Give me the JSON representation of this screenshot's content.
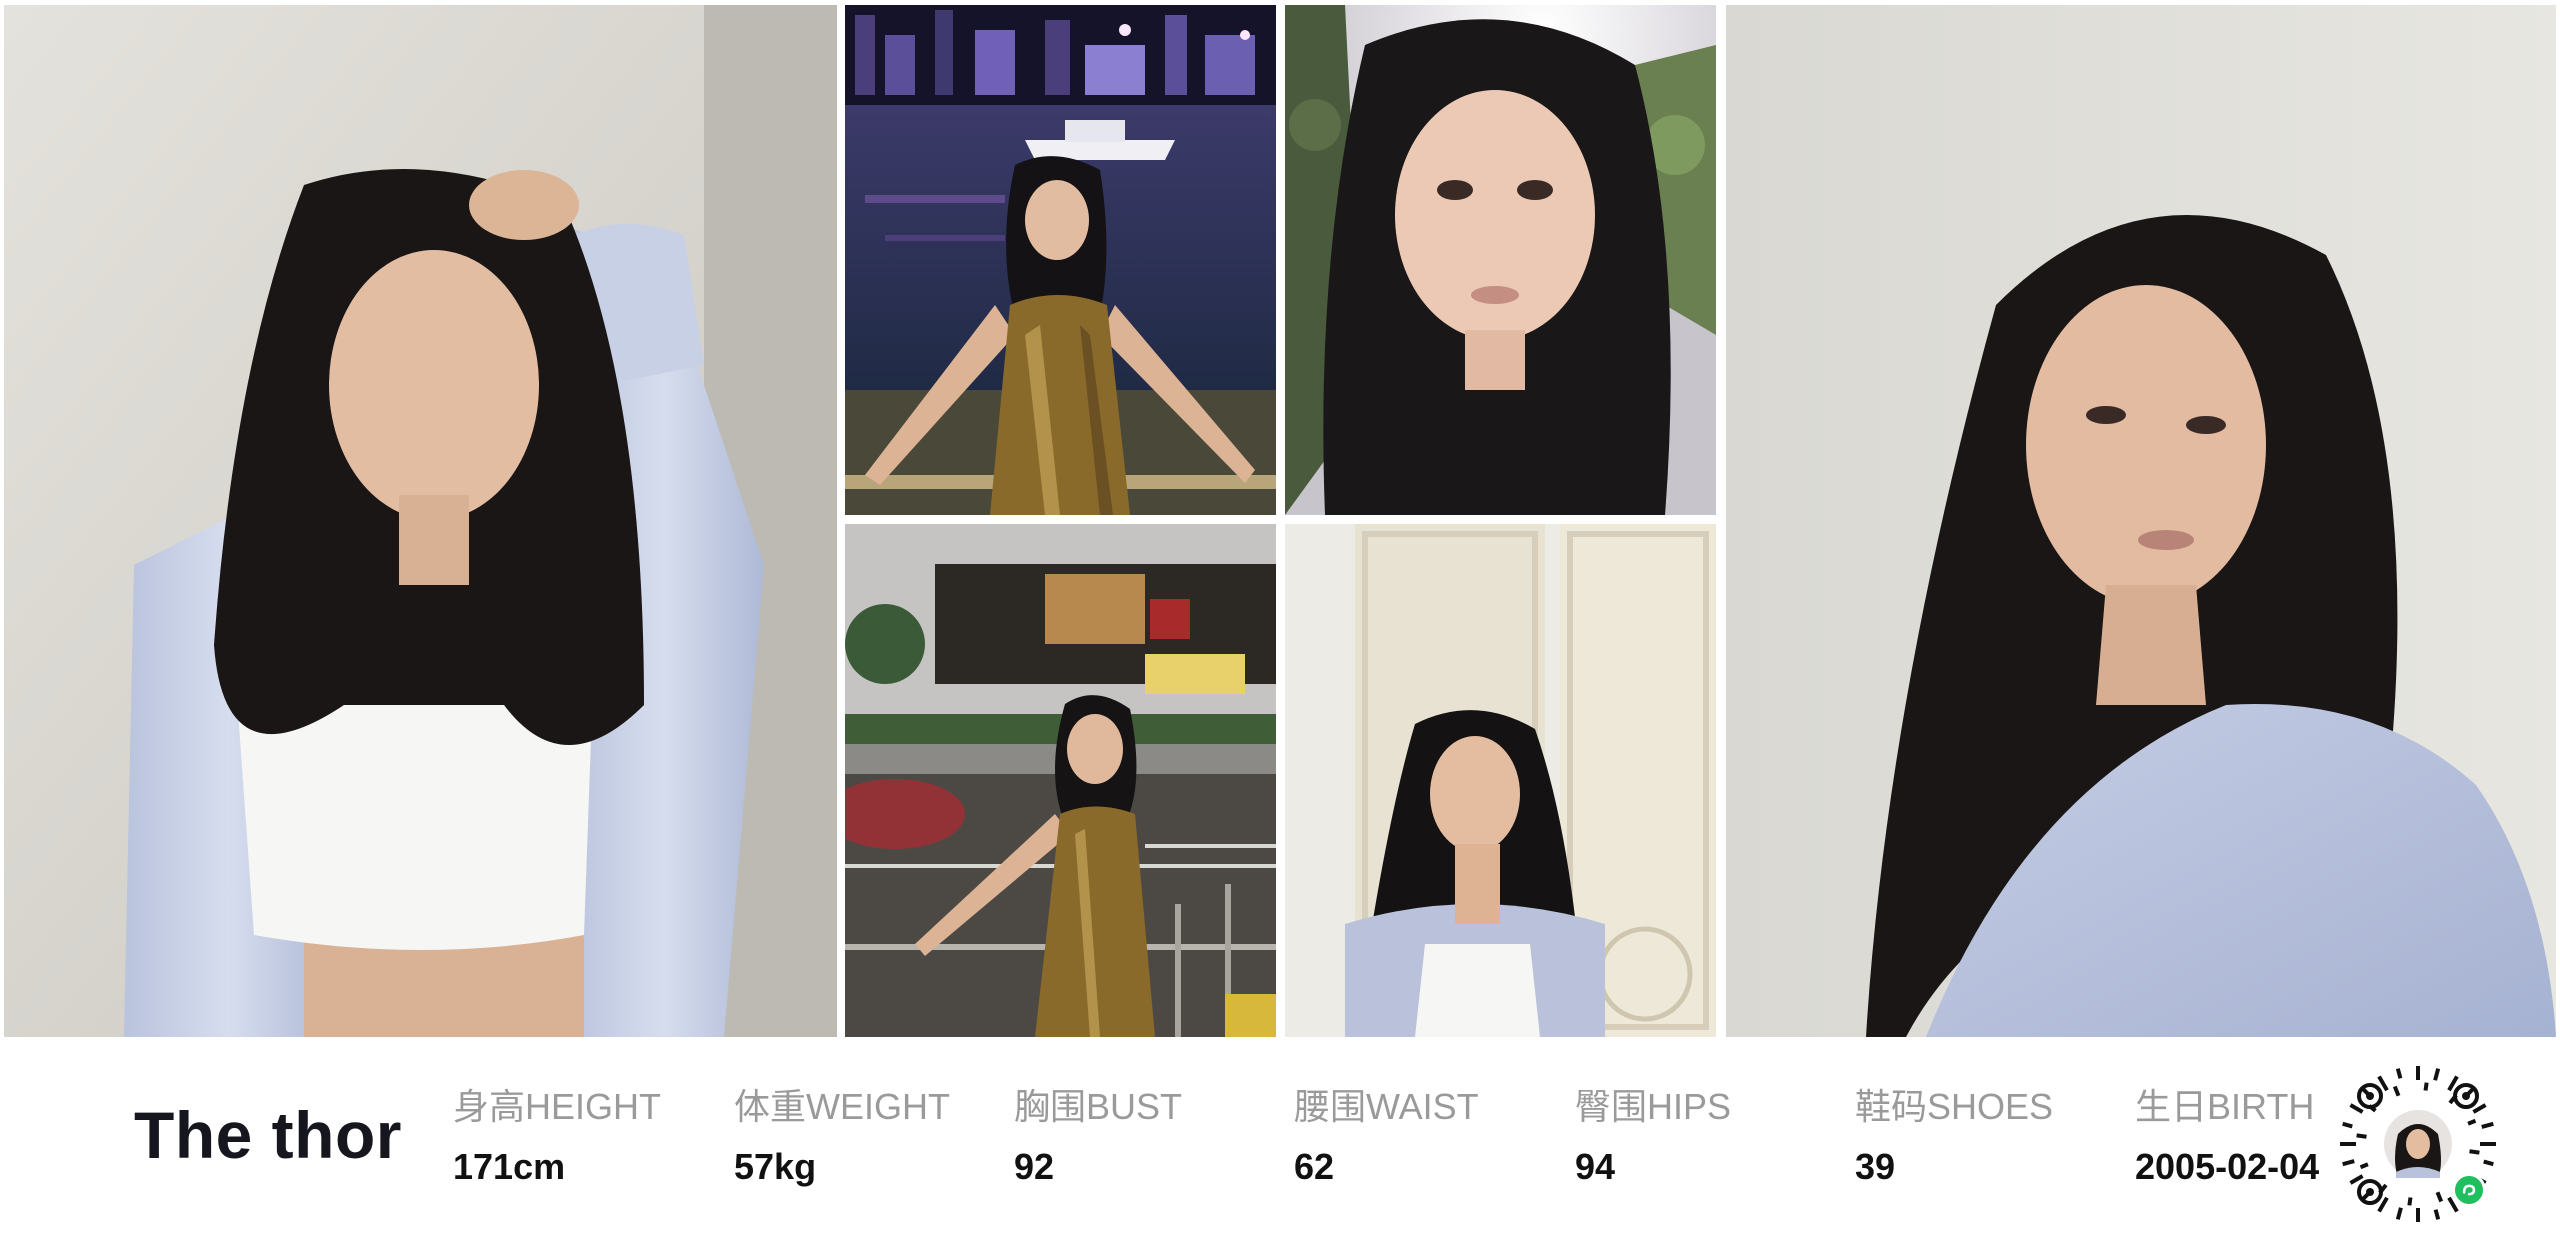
{
  "model": {
    "name": "The thor"
  },
  "stats": [
    {
      "label": "身高HEIGHT",
      "value": "171cm"
    },
    {
      "label": "体重WEIGHT",
      "value": "57kg"
    },
    {
      "label": "胸围BUST",
      "value": "92"
    },
    {
      "label": "腰围WAIST",
      "value": "62"
    },
    {
      "label": "臀围HIPS",
      "value": "94"
    },
    {
      "label": "鞋码SHOES",
      "value": "39"
    },
    {
      "label": "生日BIRTH",
      "value": "2005-02-04"
    }
  ],
  "colors": {
    "name_text": "#16161e",
    "label_text": "#9a9a9a",
    "value_text": "#111111",
    "mini_program_badge": "#1fbf5f"
  },
  "icons": {
    "qr": "mini-program-qr-code",
    "badge": "mini-program-icon"
  }
}
